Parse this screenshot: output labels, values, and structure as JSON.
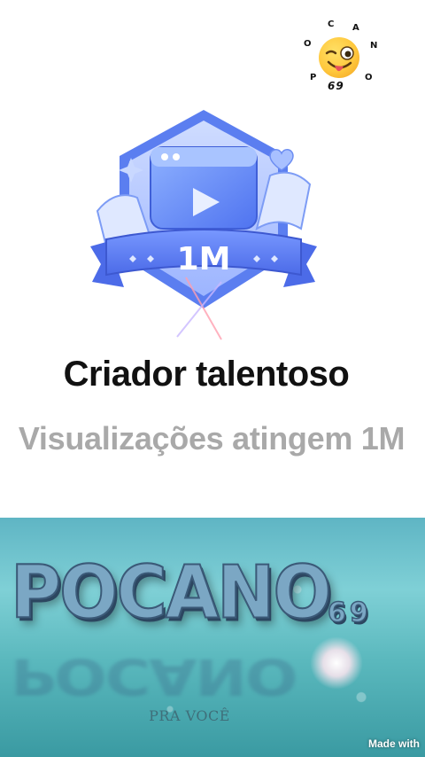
{
  "corner_logo": {
    "letters": [
      "C",
      "A",
      "O",
      "N",
      "P",
      "O"
    ],
    "number": "69",
    "icon": "winking-tongue-emoji-icon"
  },
  "badge": {
    "label": "1M",
    "icon": "video-play-badge-icon"
  },
  "title": "Criador talentoso",
  "subtitle": "Visualizações atingem 1M",
  "banner": {
    "logo_text": "POCANO",
    "logo_number": "69",
    "tagline": "PRA VOCÊ",
    "watermark": "Made with"
  },
  "colors": {
    "badge_blue": "#5b7ef0",
    "badge_light": "#a9c4ff",
    "title": "#111111",
    "subtitle": "#a9a9a9",
    "banner_teal": "#5ab8bd"
  }
}
